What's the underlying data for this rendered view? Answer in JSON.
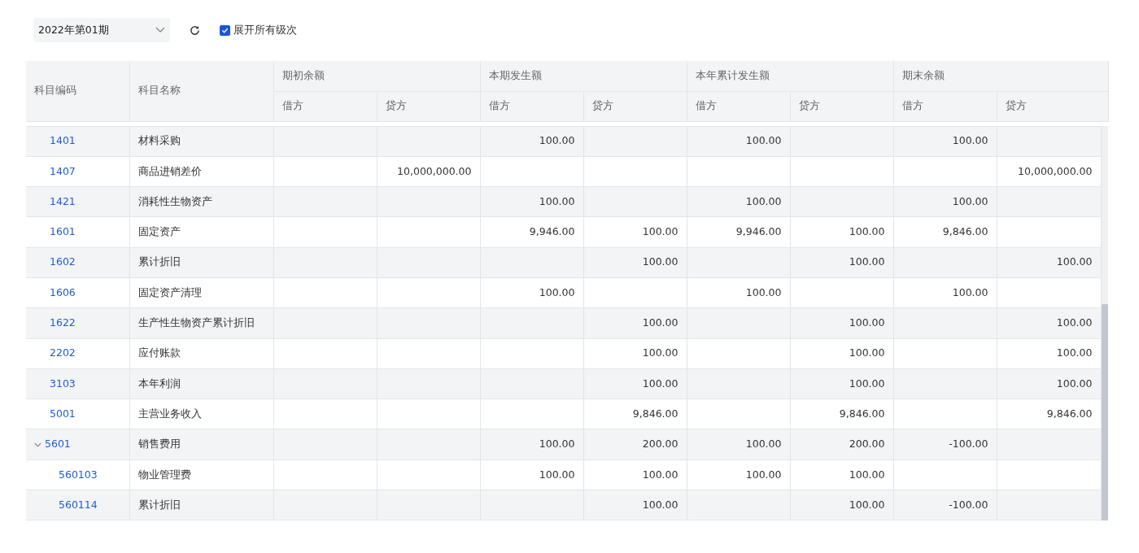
{
  "toolbar": {
    "period_select": {
      "value": "2022年第01期"
    },
    "expand_all": {
      "label": "展开所有级次",
      "checked": true
    }
  },
  "table": {
    "columns": [
      {
        "label": "科目编码"
      },
      {
        "label": "科目名称"
      }
    ],
    "groups": [
      {
        "label": "期初余额",
        "debit": "借方",
        "credit": "贷方"
      },
      {
        "label": "本期发生额",
        "debit": "借方",
        "credit": "贷方"
      },
      {
        "label": "本年累计发生额",
        "debit": "借方",
        "credit": "贷方"
      },
      {
        "label": "期末余额",
        "debit": "借方",
        "credit": "贷方"
      }
    ],
    "rows": [
      {
        "code": "1401",
        "name": "材料采购",
        "amounts": {
          "period_debit": "100.00",
          "ytd_debit": "100.00",
          "closing_debit": "100.00"
        }
      },
      {
        "code": "1407",
        "name": "商品进销差价",
        "amounts": {
          "opening_credit": "10,000,000.00",
          "closing_credit": "10,000,000.00"
        }
      },
      {
        "code": "1421",
        "name": "消耗性生物资产",
        "amounts": {
          "period_debit": "100.00",
          "ytd_debit": "100.00",
          "closing_debit": "100.00"
        }
      },
      {
        "code": "1601",
        "name": "固定资产",
        "amounts": {
          "period_debit": "9,946.00",
          "period_credit": "100.00",
          "ytd_debit": "9,946.00",
          "ytd_credit": "100.00",
          "closing_debit": "9,846.00"
        }
      },
      {
        "code": "1602",
        "name": "累计折旧",
        "amounts": {
          "period_credit": "100.00",
          "ytd_credit": "100.00",
          "closing_credit": "100.00"
        }
      },
      {
        "code": "1606",
        "name": "固定资产清理",
        "amounts": {
          "period_debit": "100.00",
          "ytd_debit": "100.00",
          "closing_debit": "100.00"
        }
      },
      {
        "code": "1622",
        "name": "生产性生物资产累计折旧",
        "amounts": {
          "period_credit": "100.00",
          "ytd_credit": "100.00",
          "closing_credit": "100.00"
        }
      },
      {
        "code": "2202",
        "name": "应付账款",
        "amounts": {
          "period_credit": "100.00",
          "ytd_credit": "100.00",
          "closing_credit": "100.00"
        }
      },
      {
        "code": "3103",
        "name": "本年利润",
        "amounts": {
          "period_credit": "100.00",
          "ytd_credit": "100.00",
          "closing_credit": "100.00"
        }
      },
      {
        "code": "5001",
        "name": "主营业务收入",
        "amounts": {
          "period_credit": "9,846.00",
          "ytd_credit": "9,846.00",
          "closing_credit": "9,846.00"
        }
      },
      {
        "code": "5601",
        "name": "销售费用",
        "expanded": true,
        "amounts": {
          "period_debit": "100.00",
          "period_credit": "200.00",
          "ytd_debit": "100.00",
          "ytd_credit": "200.00",
          "closing_debit": "-100.00"
        },
        "children": [
          {
            "code": "560103",
            "name": "物业管理费",
            "amounts": {
              "period_debit": "100.00",
              "period_credit": "100.00",
              "ytd_debit": "100.00",
              "ytd_credit": "100.00"
            }
          },
          {
            "code": "560114",
            "name": "累计折旧",
            "amounts": {
              "period_credit": "100.00",
              "ytd_credit": "100.00",
              "closing_debit": "-100.00"
            }
          }
        ]
      }
    ]
  }
}
